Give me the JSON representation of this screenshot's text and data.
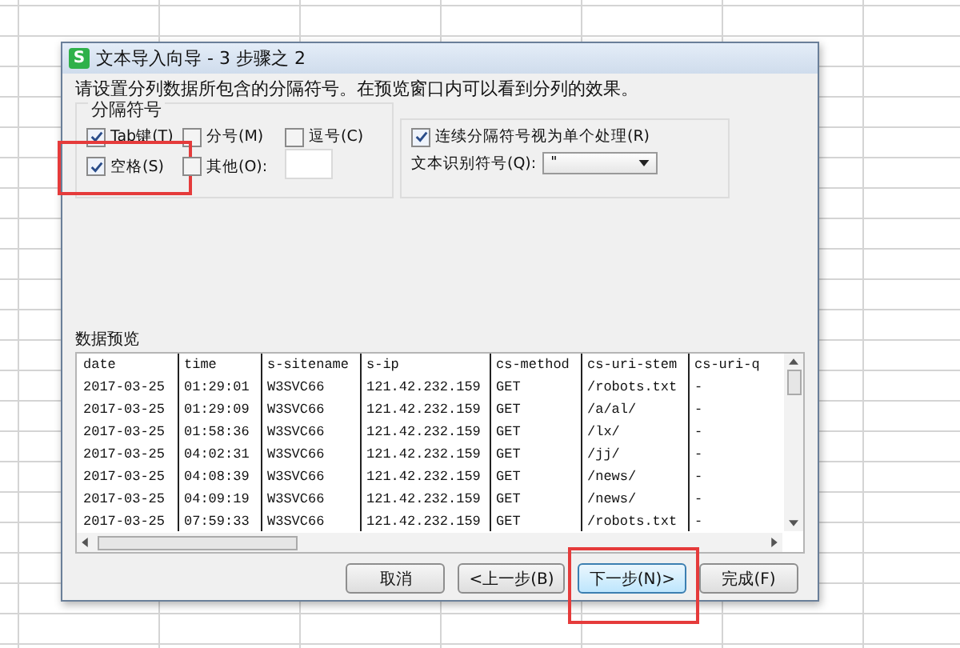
{
  "window": {
    "icon": "S",
    "title": "文本导入向导 - 3 步骤之 2"
  },
  "instruction": "请设置分列数据所包含的分隔符号。在预览窗口内可以看到分列的效果。",
  "delimiters": {
    "title": "分隔符号",
    "options": [
      {
        "label": "Tab键(T)",
        "checked": true,
        "highlighted": false
      },
      {
        "label": "分号(M)",
        "checked": false,
        "highlighted": false
      },
      {
        "label": "逗号(C)",
        "checked": false,
        "highlighted": false
      },
      {
        "label": "空格(S)",
        "checked": true,
        "highlighted": true
      },
      {
        "label": "其他(O):",
        "checked": false,
        "highlighted": false
      }
    ]
  },
  "consecutive": {
    "label": "连续分隔符号视为单个处理(R)",
    "checked": true
  },
  "text_qualifier": {
    "label": "文本识别符号(Q):",
    "value": "\""
  },
  "preview": {
    "title": "数据预览",
    "columns": [
      "date",
      "time",
      "s-sitename",
      "s-ip",
      "cs-method",
      "cs-uri-stem",
      "cs-uri-q"
    ],
    "rows": [
      [
        "2017-03-25",
        "01:29:01",
        "W3SVC66",
        "121.42.232.159",
        "GET",
        "/robots.txt",
        "-"
      ],
      [
        "2017-03-25",
        "01:29:09",
        "W3SVC66",
        "121.42.232.159",
        "GET",
        "/a/al/",
        "-"
      ],
      [
        "2017-03-25",
        "01:58:36",
        "W3SVC66",
        "121.42.232.159",
        "GET",
        "/lx/",
        "-"
      ],
      [
        "2017-03-25",
        "04:02:31",
        "W3SVC66",
        "121.42.232.159",
        "GET",
        "/jj/",
        "-"
      ],
      [
        "2017-03-25",
        "04:08:39",
        "W3SVC66",
        "121.42.232.159",
        "GET",
        "/news/",
        "-"
      ],
      [
        "2017-03-25",
        "04:09:19",
        "W3SVC66",
        "121.42.232.159",
        "GET",
        "/news/",
        "-"
      ],
      [
        "2017-03-25",
        "07:59:33",
        "W3SVC66",
        "121.42.232.159",
        "GET",
        "/robots.txt",
        "-"
      ]
    ]
  },
  "buttons": [
    {
      "label": "取消",
      "selected": false,
      "highlighted": false
    },
    {
      "label": "<上一步(B)",
      "selected": false,
      "highlighted": false
    },
    {
      "label": "下一步(N)>",
      "selected": true,
      "highlighted": true
    },
    {
      "label": "完成(F)",
      "selected": false,
      "highlighted": false
    }
  ]
}
